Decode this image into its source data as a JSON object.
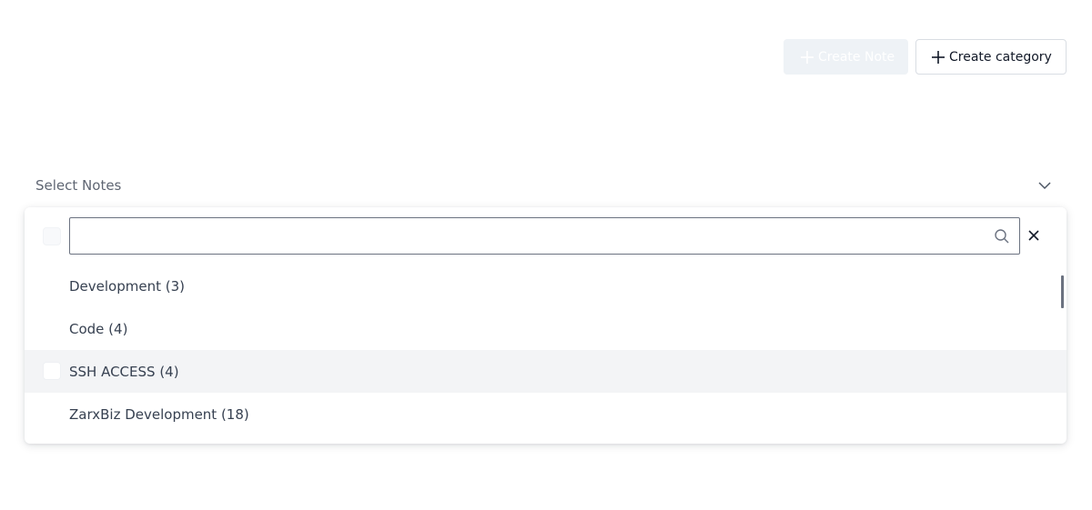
{
  "toolbar": {
    "create_note_label": "Create Note",
    "create_category_label": "Create category"
  },
  "select": {
    "placeholder": "Select Notes",
    "filter_value": "",
    "options": [
      {
        "label": "Development (3)"
      },
      {
        "label": "Code (4)"
      },
      {
        "label": "SSH ACCESS (4)",
        "highlighted": true
      },
      {
        "label": "ZarxBiz Development (18)"
      }
    ]
  },
  "icons": {
    "plus": "plus-icon",
    "chevron": "chevron-down-icon",
    "search": "search-icon",
    "close": "close-icon"
  },
  "colors": {
    "disabled_button_bg": "#eef2f6",
    "highlight_row_bg": "#f3f4f6",
    "text": "#374151"
  }
}
